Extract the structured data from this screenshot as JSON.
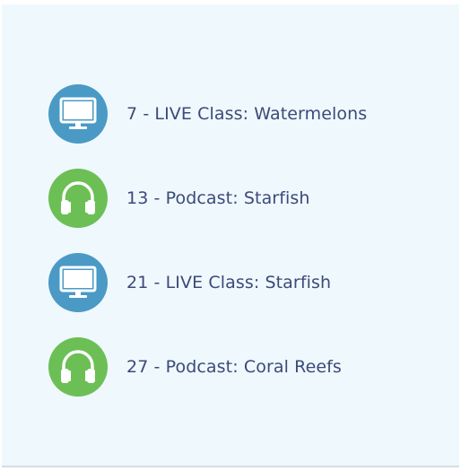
{
  "colors": {
    "background": "#eff8fd",
    "live_class": "#4a9ac5",
    "podcast": "#6cbf55",
    "text": "#3b4a78"
  },
  "items": [
    {
      "label": "7 - LIVE Class: Watermelons",
      "icon": "monitor-icon",
      "type": "live_class"
    },
    {
      "label": "13 - Podcast: Starfish",
      "icon": "headphones-icon",
      "type": "podcast"
    },
    {
      "label": "21 - LIVE Class: Starfish",
      "icon": "monitor-icon",
      "type": "live_class"
    },
    {
      "label": "27 - Podcast: Coral Reefs",
      "icon": "headphones-icon",
      "type": "podcast"
    }
  ]
}
